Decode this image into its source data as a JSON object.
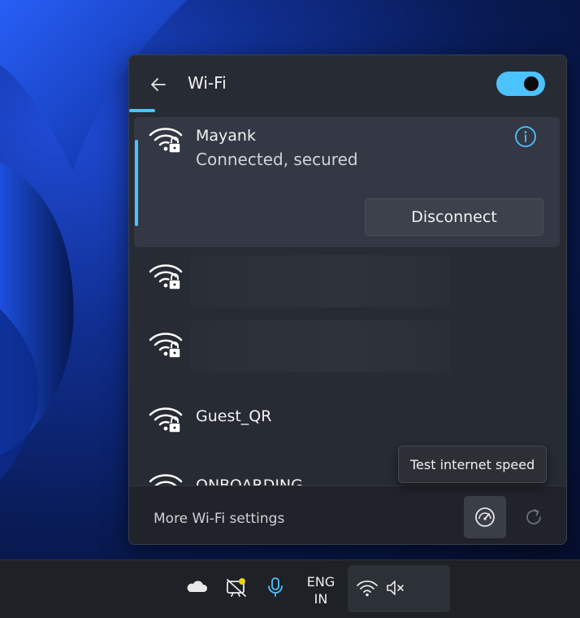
{
  "colors": {
    "accent": "#4cc2ff",
    "panel_bg": "#272b33",
    "active_item_bg": "#333844",
    "taskbar_bg": "#1e2126"
  },
  "flyout": {
    "title": "Wi-Fi",
    "back_icon": "arrow-left-icon",
    "wifi_toggle": {
      "state": "on"
    }
  },
  "networks": [
    {
      "name": "Mayank",
      "status": "Connected, secured",
      "icon": "wifi-secured-icon",
      "action_label": "Disconnect",
      "info_icon": "info-icon"
    },
    {
      "name": "",
      "icon": "wifi-secured-icon"
    },
    {
      "name": "",
      "icon": "wifi-secured-icon"
    },
    {
      "name": "Guest_QR",
      "icon": "wifi-secured-icon"
    },
    {
      "name": "ONBOARDING",
      "icon": "wifi-secured-icon"
    }
  ],
  "footer": {
    "more_settings": "More Wi-Fi settings",
    "speed_test_icon": "speedometer-icon",
    "refresh_icon": "refresh-icon"
  },
  "tooltip": {
    "text": "Test internet speed"
  },
  "taskbar": {
    "tray_icons": [
      "onedrive-icon",
      "display-notification-icon",
      "microphone-icon"
    ],
    "language_line1": "ENG",
    "language_line2": "IN",
    "quick_settings_icons": [
      "wifi-icon",
      "volume-muted-icon"
    ]
  }
}
